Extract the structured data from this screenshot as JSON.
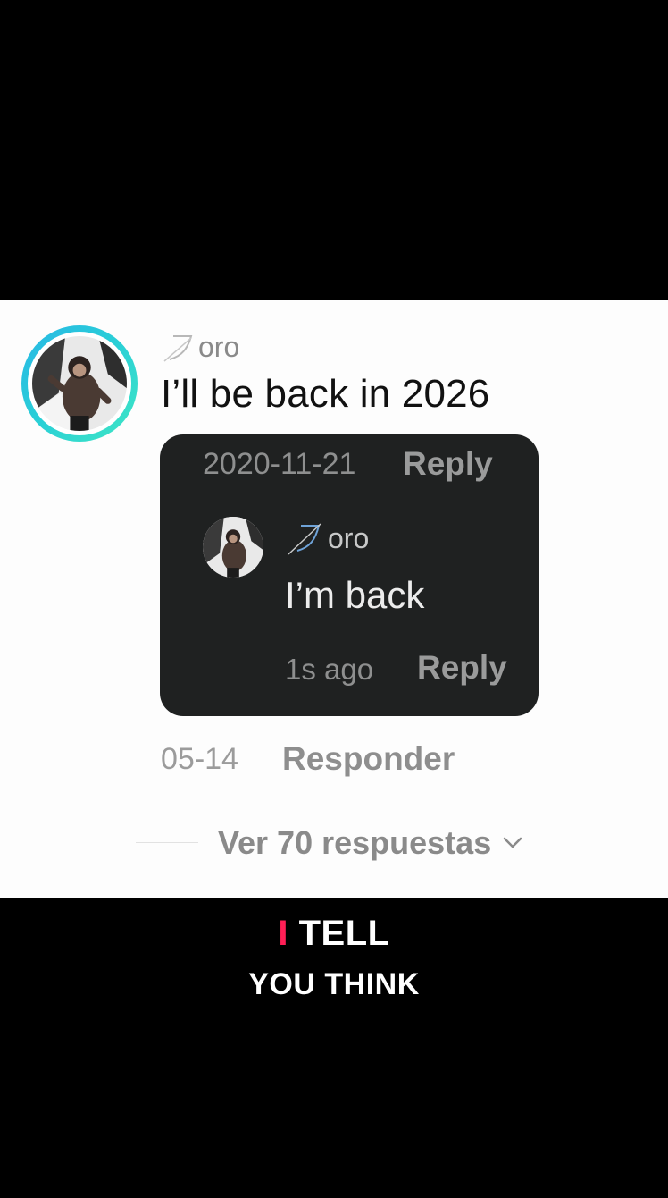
{
  "comment": {
    "username": "oro",
    "text": "I’ll be back in 2026",
    "date": "05-14",
    "reply_label": "Responder",
    "view_replies_label": "Ver 70 respuestas"
  },
  "quoted_card": {
    "date": "2020-11-21",
    "reply_top_label": "Reply",
    "reply": {
      "username": "oro",
      "text": "I’m back",
      "time": "1s ago",
      "reply_label": "Reply"
    }
  },
  "caption": {
    "line1_prefix": "I",
    "line1_rest": "TELL",
    "line2": "YOU THINK"
  },
  "colors": {
    "avatar_ring_start": "#28b7e6",
    "avatar_ring_end": "#3fe6c4",
    "caption_accent": "#ff1f56",
    "card_background": "#1f2121"
  },
  "icons": [
    "username-initial-glyph",
    "chevron-down-icon"
  ]
}
